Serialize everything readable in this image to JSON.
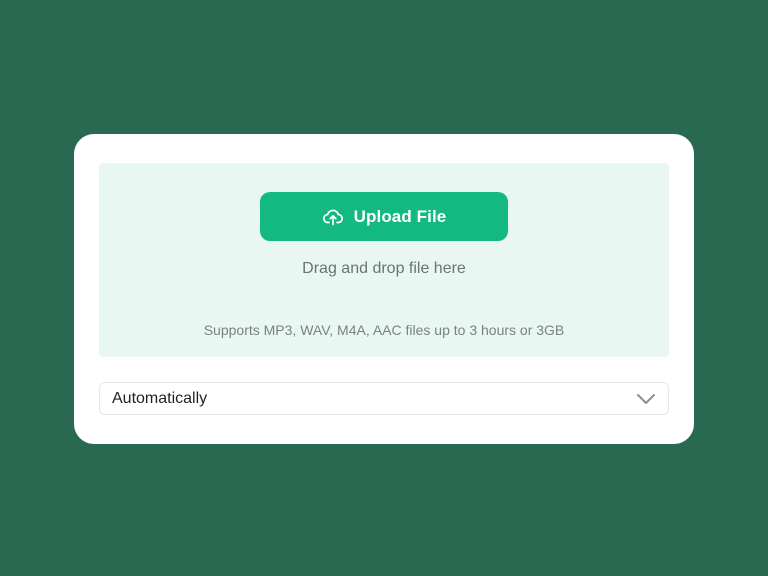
{
  "upload": {
    "button_label": "Upload File",
    "button_icon": "upload-cloud-icon",
    "drag_hint": "Drag and drop file here",
    "support_note": "Supports MP3, WAV, M4A, AAC files up to 3 hours or 3GB"
  },
  "language_select": {
    "selected": "Automatically",
    "icon": "chevron-down-icon"
  },
  "colors": {
    "background": "#2a6951",
    "card": "#ffffff",
    "dropzone": "#e8f7f1",
    "accent": "#13b980"
  }
}
